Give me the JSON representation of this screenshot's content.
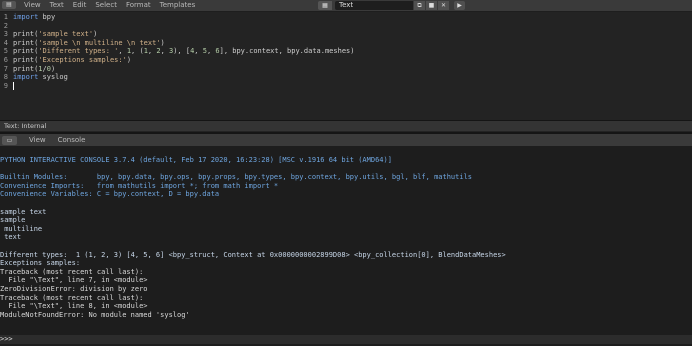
{
  "editor": {
    "type_icon": "text-editor-icon",
    "menu": [
      "View",
      "Text",
      "Edit",
      "Select",
      "Format",
      "Templates"
    ],
    "datablock": {
      "name": "Text"
    },
    "lines": [
      {
        "n": "1",
        "segs": [
          {
            "t": "import",
            "c": "kw"
          },
          {
            "t": " bpy",
            "c": ""
          }
        ]
      },
      {
        "n": "2",
        "segs": []
      },
      {
        "n": "3",
        "segs": [
          {
            "t": "print(",
            "c": ""
          },
          {
            "t": "'sample text'",
            "c": "str"
          },
          {
            "t": ")",
            "c": ""
          }
        ]
      },
      {
        "n": "4",
        "segs": [
          {
            "t": "print(",
            "c": ""
          },
          {
            "t": "'sample \\n multiline \\n text'",
            "c": "str"
          },
          {
            "t": ")",
            "c": ""
          }
        ]
      },
      {
        "n": "5",
        "segs": [
          {
            "t": "print(",
            "c": ""
          },
          {
            "t": "'Different types: '",
            "c": "str"
          },
          {
            "t": ", ",
            "c": ""
          },
          {
            "t": "1",
            "c": "numlit"
          },
          {
            "t": ", (",
            "c": ""
          },
          {
            "t": "1",
            "c": "numlit"
          },
          {
            "t": ", ",
            "c": ""
          },
          {
            "t": "2",
            "c": "numlit"
          },
          {
            "t": ", ",
            "c": ""
          },
          {
            "t": "3",
            "c": "numlit"
          },
          {
            "t": "), [",
            "c": ""
          },
          {
            "t": "4",
            "c": "numlit"
          },
          {
            "t": ", ",
            "c": ""
          },
          {
            "t": "5",
            "c": "numlit"
          },
          {
            "t": ", ",
            "c": ""
          },
          {
            "t": "6",
            "c": "numlit"
          },
          {
            "t": "], bpy.context, bpy.data.meshes)",
            "c": ""
          }
        ]
      },
      {
        "n": "6",
        "segs": [
          {
            "t": "print(",
            "c": ""
          },
          {
            "t": "'Exceptions samples:'",
            "c": "str"
          },
          {
            "t": ")",
            "c": ""
          }
        ]
      },
      {
        "n": "7",
        "segs": [
          {
            "t": "print(",
            "c": ""
          },
          {
            "t": "1",
            "c": "numlit"
          },
          {
            "t": "/",
            "c": ""
          },
          {
            "t": "0",
            "c": "numlit"
          },
          {
            "t": ")",
            "c": ""
          }
        ]
      },
      {
        "n": "8",
        "segs": [
          {
            "t": "import",
            "c": "kw"
          },
          {
            "t": " syslog",
            "c": ""
          }
        ]
      },
      {
        "n": "9",
        "segs": []
      }
    ],
    "footer": "Text: Internal"
  },
  "console": {
    "menu": [
      "View",
      "Console"
    ],
    "lines": [
      {
        "t": "PYTHON INTERACTIVE CONSOLE 3.7.4 (default, Feb 17 2020, 16:23:28) [MSC v.1916 64 bit (AMD64)]",
        "c": "c-info"
      },
      {
        "t": "",
        "c": ""
      },
      {
        "t": "Builtin Modules:       bpy, bpy.data, bpy.ops, bpy.props, bpy.types, bpy.context, bpy.utils, bgl, blf, mathutils",
        "c": "c-info"
      },
      {
        "t": "Convenience Imports:   from mathutils import *; from math import *",
        "c": "c-info"
      },
      {
        "t": "Convenience Variables: C = bpy.context, D = bpy.data",
        "c": "c-info"
      },
      {
        "t": "",
        "c": ""
      },
      {
        "t": "sample text",
        "c": "c-out"
      },
      {
        "t": "sample",
        "c": "c-out"
      },
      {
        "t": " multiline",
        "c": "c-out"
      },
      {
        "t": " text",
        "c": "c-out"
      },
      {
        "t": "",
        "c": ""
      },
      {
        "t": "Different types:  1 (1, 2, 3) [4, 5, 6] <bpy_struct, Context at 0x0000000002899D08> <bpy_collection[0], BlendDataMeshes>",
        "c": "c-out"
      },
      {
        "t": "Exceptions samples:",
        "c": "c-out"
      },
      {
        "t": "Traceback (most recent call last):",
        "c": "c-err"
      },
      {
        "t": "  File \"\\Text\", line 7, in <module>",
        "c": "c-err"
      },
      {
        "t": "ZeroDivisionError: division by zero",
        "c": "c-err"
      },
      {
        "t": "Traceback (most recent call last):",
        "c": "c-err"
      },
      {
        "t": "  File \"\\Text\", line 8, in <module>",
        "c": "c-err"
      },
      {
        "t": "ModuleNotFoundError: No module named 'syslog'",
        "c": "c-err"
      }
    ],
    "prompt": ">>> "
  }
}
